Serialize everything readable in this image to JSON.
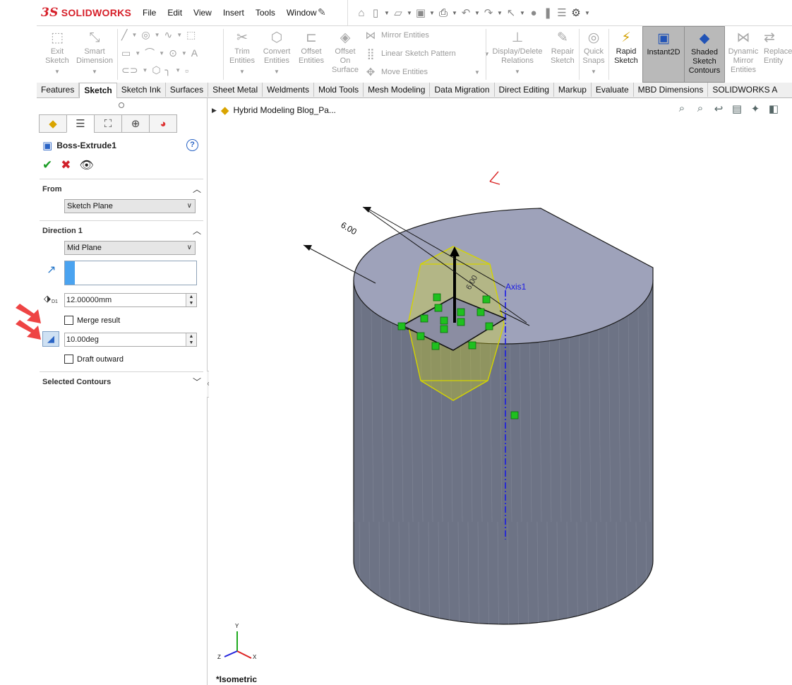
{
  "app": {
    "logo_text": "SOLIDWORKS",
    "logo_mark": "3S"
  },
  "menu": [
    "File",
    "Edit",
    "View",
    "Insert",
    "Tools",
    "Window"
  ],
  "command_manager": {
    "exit_sketch": [
      "Exit",
      "Sketch"
    ],
    "smart_dimension": [
      "Smart",
      "Dimension"
    ],
    "trim": [
      "Trim",
      "Entities"
    ],
    "convert": [
      "Convert",
      "Entities"
    ],
    "offset": [
      "Offset",
      "Entities"
    ],
    "offset_surface": [
      "Offset",
      "On",
      "Surface"
    ],
    "mirror": "Mirror Entities",
    "linear_pattern": "Linear Sketch Pattern",
    "move": "Move Entities",
    "display_relations": [
      "Display/Delete",
      "Relations"
    ],
    "repair": [
      "Repair",
      "Sketch"
    ],
    "quick_snaps": [
      "Quick",
      "Snaps"
    ],
    "rapid_sketch": [
      "Rapid",
      "Sketch"
    ],
    "instant2d": [
      "Instant2D"
    ],
    "shaded_contours": [
      "Shaded",
      "Sketch",
      "Contours"
    ],
    "dynamic_mirror": [
      "Dynamic",
      "Mirror",
      "Entities"
    ],
    "replace_entity": [
      "Replace",
      "Entity"
    ]
  },
  "tabs": [
    "Features",
    "Sketch",
    "Sketch Ink",
    "Surfaces",
    "Sheet Metal",
    "Weldments",
    "Mold Tools",
    "Mesh Modeling",
    "Data Migration",
    "Direct Editing",
    "Markup",
    "Evaluate",
    "MBD Dimensions",
    "SOLIDWORKS A"
  ],
  "active_tab": "Sketch",
  "property_manager": {
    "title": "Boss-Extrude1",
    "from_section": "From",
    "from_value": "Sketch Plane",
    "direction_section": "Direction 1",
    "direction_value": "Mid Plane",
    "depth": "12.00000mm",
    "depth_label": "D1",
    "merge_result": "Merge result",
    "merge_result_checked": false,
    "draft_angle": "10.00deg",
    "draft_outward": "Draft outward",
    "draft_outward_checked": false,
    "selected_contours": "Selected Contours"
  },
  "graphics": {
    "tree_item": "Hybrid Modeling Blog_Pa...",
    "view_name": "*Isometric",
    "axis_label": "Axis1",
    "dimension_1": "6.00",
    "dimension_2": "6.00",
    "triad": {
      "y": "Y",
      "x": "X",
      "z": "Z"
    },
    "colors": {
      "cylinder_side": "#707687",
      "cylinder_top": "#9fa3bb",
      "extrude_preview": "#e8e800",
      "handle_green": "#1fc01f",
      "axis_blue": "#1a1ae6"
    }
  }
}
